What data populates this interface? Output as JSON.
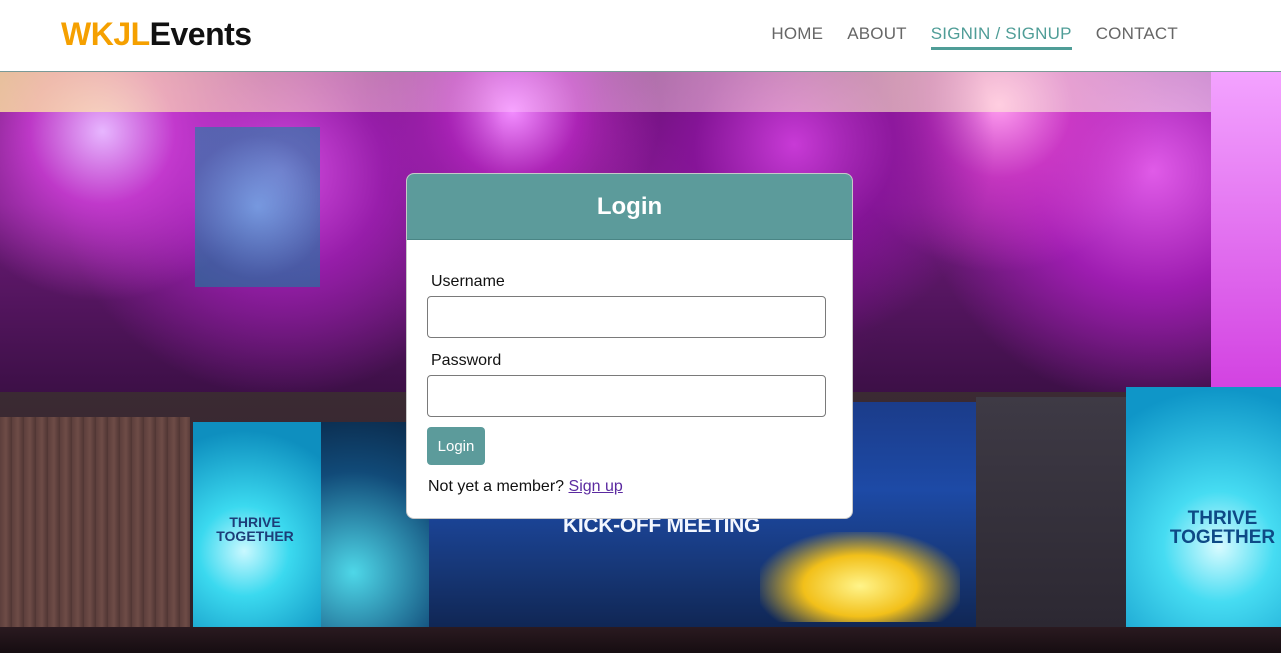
{
  "brand": {
    "part1": "WKJL",
    "part2": "Events",
    "colors": {
      "accent": "#f5a000",
      "dark": "#111111"
    }
  },
  "nav": {
    "items": [
      {
        "label": "HOME",
        "active": false
      },
      {
        "label": "ABOUT",
        "active": false
      },
      {
        "label": "SIGNIN / SIGNUP",
        "active": true
      },
      {
        "label": "CONTACT",
        "active": false
      }
    ],
    "active_color": "#4f9d97"
  },
  "hero": {
    "background_text": {
      "left_panel": "THRIVE TOGETHER",
      "center_screen": "KICK-OFF MEETING",
      "right_panel": "THRIVE TOGETHER"
    }
  },
  "login": {
    "title": "Login",
    "username_label": "Username",
    "username_value": "",
    "password_label": "Password",
    "password_value": "",
    "submit_label": "Login",
    "signup_prompt": "Not yet a member?",
    "signup_link": "Sign up",
    "colors": {
      "header": "#5c9b9b",
      "link": "#5b2aa0"
    }
  }
}
